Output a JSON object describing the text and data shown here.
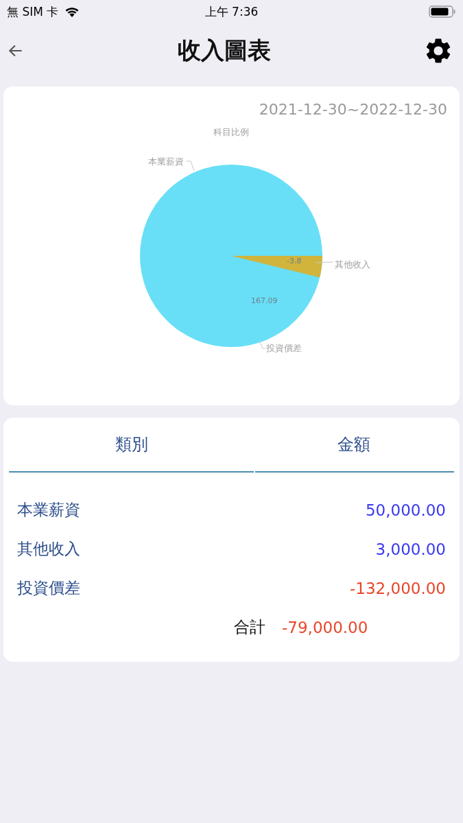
{
  "status_bar": {
    "carrier": "無 SIM 卡",
    "time": "上午 7:36"
  },
  "nav": {
    "title": "收入圖表"
  },
  "chart_card": {
    "date_range": "2021-12-30~2022-12-30",
    "pie": {
      "title": "科目比例",
      "slices": [
        {
          "label": "本業薪資"
        },
        {
          "label": "其他收入",
          "value_label": "-3.8",
          "color": "#d1b43c"
        },
        {
          "label": "投資價差",
          "value_label": "167.09",
          "color": "#68dff7"
        }
      ]
    }
  },
  "table": {
    "columns": [
      "類別",
      "金額"
    ],
    "rows": [
      {
        "category": "本業薪資",
        "amount": "50,000.00",
        "color": "#3a3af0"
      },
      {
        "category": "其他收入",
        "amount": "3,000.00",
        "color": "#3a3af0"
      },
      {
        "category": "投資價差",
        "amount": "-132,000.00",
        "color": "#e8472b"
      }
    ],
    "total": {
      "label": "合計",
      "amount": "-79,000.00",
      "color": "#e8472b"
    }
  }
}
